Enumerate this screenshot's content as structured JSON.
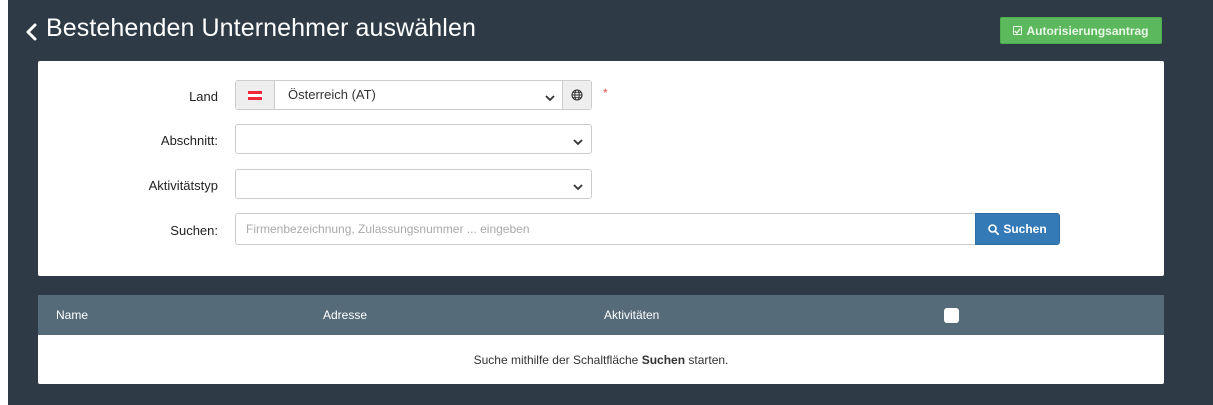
{
  "header": {
    "title": "Bestehenden Unternehmer auswählen",
    "auth_button_label": "Autorisierungsantrag"
  },
  "form": {
    "land": {
      "label": "Land",
      "value": "Österreich (AT)",
      "required_marker": "*",
      "flag": {
        "top": "#ed2939",
        "middle": "#ffffff",
        "bottom": "#ed2939"
      }
    },
    "abschnitt": {
      "label": "Abschnitt:",
      "value": ""
    },
    "aktivitaetstyp": {
      "label": "Aktivitätstyp",
      "value": ""
    },
    "suchen": {
      "label": "Suchen:",
      "placeholder": "Firmenbezeichnung, Zulassungsnummer ... eingeben",
      "value": "",
      "button_label": "Suchen"
    }
  },
  "table": {
    "columns": [
      "Name",
      "Adresse",
      "Aktivitäten"
    ],
    "empty_message": {
      "before": "Suche mithilfe der Schaltfläche ",
      "bold": "Suchen",
      "after": " starten."
    }
  },
  "colors": {
    "background": "#2e3b46",
    "table_header": "#566b79",
    "primary": "#337ab7",
    "success": "#5cb85c",
    "required": "#d9534f"
  }
}
